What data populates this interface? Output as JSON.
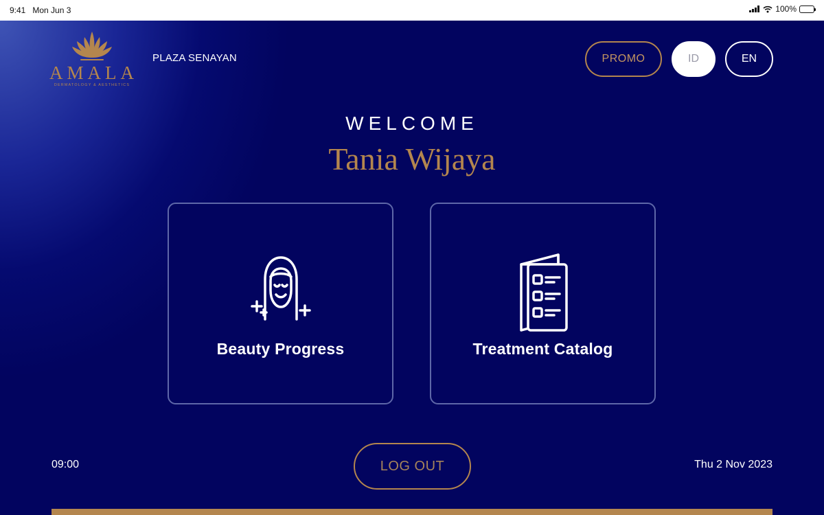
{
  "status_bar": {
    "time": "9:41",
    "date": "Mon Jun 3",
    "battery": "100%"
  },
  "header": {
    "brand": "AMALA",
    "tagline": "DERMATOLOGY & AESTHETICS",
    "location": "PLAZA SENAYAN",
    "promo_label": "PROMO",
    "lang_id_label": "ID",
    "lang_en_label": "EN",
    "selected_language": "ID"
  },
  "main": {
    "welcome": "WELCOME",
    "user_name": "Tania Wijaya",
    "cards": [
      {
        "label": "Beauty Progress",
        "icon": "face-icon"
      },
      {
        "label": "Treatment Catalog",
        "icon": "catalog-icon"
      }
    ]
  },
  "footer": {
    "clock": "09:00",
    "logout_label": "LOG OUT",
    "date": "Thu 2 Nov 2023"
  },
  "colors": {
    "background": "#02045f",
    "gold": "#b4864e",
    "white": "#ffffff"
  }
}
